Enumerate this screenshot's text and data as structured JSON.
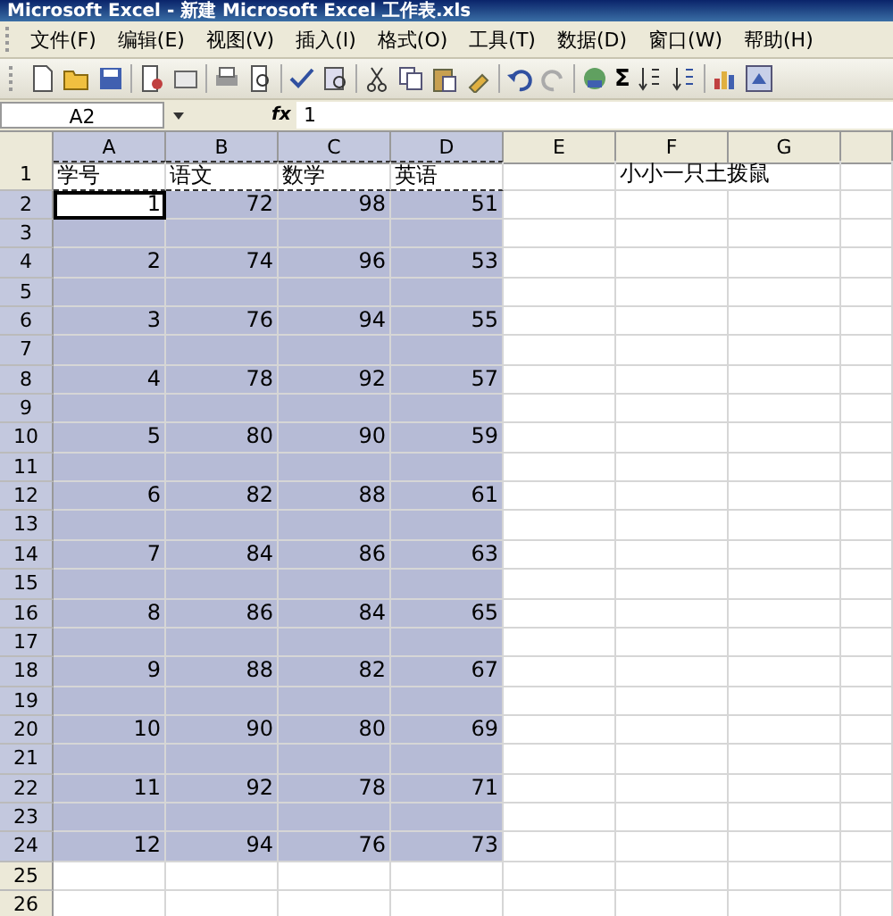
{
  "window": {
    "title": "Microsoft Excel - 新建 Microsoft Excel 工作表.xls"
  },
  "menu": [
    "文件(F)",
    "编辑(E)",
    "视图(V)",
    "插入(I)",
    "格式(O)",
    "工具(T)",
    "数据(D)",
    "窗口(W)",
    "帮助(H)"
  ],
  "toolbar": {
    "sum_label": "Σ"
  },
  "formula_bar": {
    "name_box": "A2",
    "fx_label": "fx",
    "value": "1"
  },
  "columns": [
    {
      "label": "A",
      "selected": true
    },
    {
      "label": "B",
      "selected": true
    },
    {
      "label": "C",
      "selected": true
    },
    {
      "label": "D",
      "selected": true
    },
    {
      "label": "E",
      "selected": false
    },
    {
      "label": "F",
      "selected": false
    },
    {
      "label": "G",
      "selected": false
    }
  ],
  "rows": [
    {
      "label": "1",
      "selected": false,
      "cells": [
        {
          "text": "学号",
          "marquee": true,
          "active": false
        },
        {
          "text": "语文",
          "marquee": true,
          "active": false
        },
        {
          "text": "数学",
          "marquee": true,
          "active": false
        },
        {
          "text": "英语",
          "marquee": true,
          "active": false
        },
        null,
        {
          "text": "小小一只土拨鼠",
          "marquee": false,
          "active": false
        },
        null
      ]
    },
    {
      "label": "2",
      "selected": true,
      "cells": [
        {
          "text": "1",
          "marquee": false,
          "active": true
        },
        {
          "text": "72",
          "marquee": false,
          "active": false
        },
        {
          "text": "98",
          "marquee": false,
          "active": false
        },
        {
          "text": "51",
          "marquee": false,
          "active": false
        },
        null,
        null,
        null
      ]
    },
    {
      "label": "3",
      "selected": true,
      "cells": [
        null,
        null,
        null,
        null,
        null,
        null,
        null
      ]
    },
    {
      "label": "4",
      "selected": true,
      "cells": [
        {
          "text": "2",
          "marquee": false,
          "active": false
        },
        {
          "text": "74",
          "marquee": false,
          "active": false
        },
        {
          "text": "96",
          "marquee": false,
          "active": false
        },
        {
          "text": "53",
          "marquee": false,
          "active": false
        },
        null,
        null,
        null
      ]
    },
    {
      "label": "5",
      "selected": true,
      "cells": [
        null,
        null,
        null,
        null,
        null,
        null,
        null
      ]
    },
    {
      "label": "6",
      "selected": true,
      "cells": [
        {
          "text": "3",
          "marquee": false,
          "active": false
        },
        {
          "text": "76",
          "marquee": false,
          "active": false
        },
        {
          "text": "94",
          "marquee": false,
          "active": false
        },
        {
          "text": "55",
          "marquee": false,
          "active": false
        },
        null,
        null,
        null
      ]
    },
    {
      "label": "7",
      "selected": true,
      "cells": [
        null,
        null,
        null,
        null,
        null,
        null,
        null
      ]
    },
    {
      "label": "8",
      "selected": true,
      "cells": [
        {
          "text": "4",
          "marquee": false,
          "active": false
        },
        {
          "text": "78",
          "marquee": false,
          "active": false
        },
        {
          "text": "92",
          "marquee": false,
          "active": false
        },
        {
          "text": "57",
          "marquee": false,
          "active": false
        },
        null,
        null,
        null
      ]
    },
    {
      "label": "9",
      "selected": true,
      "cells": [
        null,
        null,
        null,
        null,
        null,
        null,
        null
      ]
    },
    {
      "label": "10",
      "selected": true,
      "cells": [
        {
          "text": "5",
          "marquee": false,
          "active": false
        },
        {
          "text": "80",
          "marquee": false,
          "active": false
        },
        {
          "text": "90",
          "marquee": false,
          "active": false
        },
        {
          "text": "59",
          "marquee": false,
          "active": false
        },
        null,
        null,
        null
      ]
    },
    {
      "label": "11",
      "selected": true,
      "cells": [
        null,
        null,
        null,
        null,
        null,
        null,
        null
      ]
    },
    {
      "label": "12",
      "selected": true,
      "cells": [
        {
          "text": "6",
          "marquee": false,
          "active": false
        },
        {
          "text": "82",
          "marquee": false,
          "active": false
        },
        {
          "text": "88",
          "marquee": false,
          "active": false
        },
        {
          "text": "61",
          "marquee": false,
          "active": false
        },
        null,
        null,
        null
      ]
    },
    {
      "label": "13",
      "selected": true,
      "cells": [
        null,
        null,
        null,
        null,
        null,
        null,
        null
      ]
    },
    {
      "label": "14",
      "selected": true,
      "cells": [
        {
          "text": "7",
          "marquee": false,
          "active": false
        },
        {
          "text": "84",
          "marquee": false,
          "active": false
        },
        {
          "text": "86",
          "marquee": false,
          "active": false
        },
        {
          "text": "63",
          "marquee": false,
          "active": false
        },
        null,
        null,
        null
      ]
    },
    {
      "label": "15",
      "selected": true,
      "cells": [
        null,
        null,
        null,
        null,
        null,
        null,
        null
      ]
    },
    {
      "label": "16",
      "selected": true,
      "cells": [
        {
          "text": "8",
          "marquee": false,
          "active": false
        },
        {
          "text": "86",
          "marquee": false,
          "active": false
        },
        {
          "text": "84",
          "marquee": false,
          "active": false
        },
        {
          "text": "65",
          "marquee": false,
          "active": false
        },
        null,
        null,
        null
      ]
    },
    {
      "label": "17",
      "selected": true,
      "cells": [
        null,
        null,
        null,
        null,
        null,
        null,
        null
      ]
    },
    {
      "label": "18",
      "selected": true,
      "cells": [
        {
          "text": "9",
          "marquee": false,
          "active": false
        },
        {
          "text": "88",
          "marquee": false,
          "active": false
        },
        {
          "text": "82",
          "marquee": false,
          "active": false
        },
        {
          "text": "67",
          "marquee": false,
          "active": false
        },
        null,
        null,
        null
      ]
    },
    {
      "label": "19",
      "selected": true,
      "cells": [
        null,
        null,
        null,
        null,
        null,
        null,
        null
      ]
    },
    {
      "label": "20",
      "selected": true,
      "cells": [
        {
          "text": "10",
          "marquee": false,
          "active": false
        },
        {
          "text": "90",
          "marquee": false,
          "active": false
        },
        {
          "text": "80",
          "marquee": false,
          "active": false
        },
        {
          "text": "69",
          "marquee": false,
          "active": false
        },
        null,
        null,
        null
      ]
    },
    {
      "label": "21",
      "selected": true,
      "cells": [
        null,
        null,
        null,
        null,
        null,
        null,
        null
      ]
    },
    {
      "label": "22",
      "selected": true,
      "cells": [
        {
          "text": "11",
          "marquee": false,
          "active": false
        },
        {
          "text": "92",
          "marquee": false,
          "active": false
        },
        {
          "text": "78",
          "marquee": false,
          "active": false
        },
        {
          "text": "71",
          "marquee": false,
          "active": false
        },
        null,
        null,
        null
      ]
    },
    {
      "label": "23",
      "selected": true,
      "cells": [
        null,
        null,
        null,
        null,
        null,
        null,
        null
      ]
    },
    {
      "label": "24",
      "selected": true,
      "cells": [
        {
          "text": "12",
          "marquee": false,
          "active": false
        },
        {
          "text": "94",
          "marquee": false,
          "active": false
        },
        {
          "text": "76",
          "marquee": false,
          "active": false
        },
        {
          "text": "73",
          "marquee": false,
          "active": false
        },
        null,
        null,
        null
      ]
    },
    {
      "label": "25",
      "selected": false,
      "cells": [
        null,
        null,
        null,
        null,
        null,
        null,
        null
      ]
    },
    {
      "label": "26",
      "selected": false,
      "cells": [
        null,
        null,
        null,
        null,
        null,
        null,
        null
      ]
    }
  ]
}
